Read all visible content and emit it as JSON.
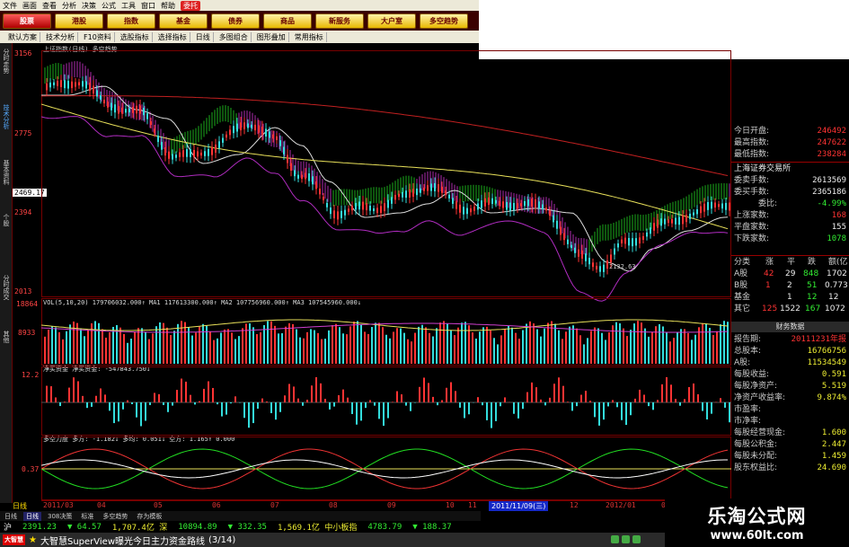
{
  "menu": {
    "items": [
      "文件",
      "画面",
      "查看",
      "分析",
      "决策",
      "公式",
      "工具",
      "窗口",
      "帮助"
    ],
    "badge": "委托"
  },
  "nav": {
    "buttons": [
      "股票",
      "港股",
      "指数",
      "基金",
      "债券",
      "商品",
      "新服务",
      "大户室",
      "多空趋势"
    ]
  },
  "toolbar": {
    "items": [
      "默认方案",
      "技术分析",
      "F10资料",
      "选股指标",
      "选择指标",
      "日线",
      "多图组合",
      "图形叠加",
      "常用指标"
    ]
  },
  "sidebar": {
    "tabs": [
      "分时走势",
      "技术分析",
      "基本资料",
      "个股",
      "分时成交",
      "其他"
    ]
  },
  "chart_header": {
    "text": "上证指数(日线)  多空趋势"
  },
  "price_axis": {
    "labels": [
      "3156",
      "2775",
      "2394",
      "2013"
    ],
    "current": "2469.17"
  },
  "low_annotation": "2132.63",
  "volume_pane": {
    "header": "VOL(5,10,20)  179706032.000↑ MA1  117613300.000↑ MA2  107756960.000↑ MA3  107545960.000↓",
    "labels": [
      "18864",
      "8933"
    ]
  },
  "netcap_pane": {
    "header": "净买资金  净买资金: -547843.750↓",
    "labels": [
      "12.2"
    ]
  },
  "trend_pane": {
    "header": "多空力度  多方: -1.182↓  多均: 0.051↓  空方: 1.165↑  0.000",
    "labels": [
      "0.37"
    ]
  },
  "x_axis": {
    "labels": [
      "2011/03",
      "04",
      "05",
      "06",
      "07",
      "08",
      "09",
      "10",
      "11",
      "12",
      "2012/01",
      "02"
    ],
    "date_flag": "2011/11/09(三)",
    "period_label": "日线"
  },
  "right_panel": {
    "quotes": [
      {
        "label": "今日开盘:",
        "value": "246492",
        "color": "red"
      },
      {
        "label": "最高指数:",
        "value": "247622",
        "color": "red"
      },
      {
        "label": "最低指数:",
        "value": "238284",
        "color": "red"
      }
    ],
    "exchange_title": "上海证券交易所",
    "orders": [
      {
        "label": "委卖手数:",
        "value": "2613569",
        "color": "white"
      },
      {
        "label": "委买手数:",
        "value": "2365186",
        "color": "white"
      },
      {
        "label": "委比:",
        "value": "-4.99%",
        "color": "green"
      },
      {
        "label": "上涨家数:",
        "value": "168",
        "color": "red"
      },
      {
        "label": "平盘家数:",
        "value": "155",
        "color": "white"
      },
      {
        "label": "下跌家数:",
        "value": "1078",
        "color": "green"
      }
    ],
    "table": {
      "headers": [
        "分类",
        "涨",
        "平",
        "跌",
        "额(亿"
      ],
      "rows": [
        [
          "A股",
          "42",
          "29",
          "848",
          "1702"
        ],
        [
          "B股",
          "1",
          "2",
          "51",
          "0.773"
        ],
        [
          "基金",
          "",
          "1",
          "12",
          "12"
        ],
        [
          "其它",
          "125",
          "1522",
          "167",
          "1072"
        ]
      ]
    },
    "finance_title": "财务数据",
    "finance": [
      {
        "label": "报告期:",
        "value": "20111231年报",
        "color": "red"
      },
      {
        "label": "总股本:",
        "value": "16766756",
        "color": "yellow"
      },
      {
        "label": "A股:",
        "value": "11534549",
        "color": "yellow"
      },
      {
        "label": "每股收益:",
        "value": "0.591",
        "color": "yellow"
      },
      {
        "label": "每股净资产:",
        "value": "5.519",
        "color": "yellow"
      },
      {
        "label": "净资产收益率:",
        "value": "9.874%",
        "color": "yellow"
      },
      {
        "label": "市盈率:",
        "value": "",
        "color": "yellow"
      },
      {
        "label": "市净率:",
        "value": "",
        "color": "yellow"
      },
      {
        "label": "每股经营现金:",
        "value": "1.600",
        "color": "yellow"
      },
      {
        "label": "每股公积金:",
        "value": "2.447",
        "color": "yellow"
      },
      {
        "label": "每股未分配:",
        "value": "1.459",
        "color": "yellow"
      },
      {
        "label": "股东权益比:",
        "value": "24.690",
        "color": "yellow"
      }
    ]
  },
  "bottom_tabs": [
    "日线",
    "日线",
    "308决策",
    "标准",
    "多空趋势",
    "存为模板"
  ],
  "ticker": [
    {
      "text": "沪",
      "color": "white"
    },
    {
      "text": "2391.23",
      "color": "green"
    },
    {
      "text": "▼ 64.57",
      "color": "green"
    },
    {
      "text": "1,707.4亿 深",
      "color": "yellow"
    },
    {
      "text": "10894.89",
      "color": "green"
    },
    {
      "text": "▼ 332.35",
      "color": "green"
    },
    {
      "text": "1,569.1亿 中小板指",
      "color": "yellow"
    },
    {
      "text": "4783.79",
      "color": "green"
    },
    {
      "text": "▼ 188.37",
      "color": "green"
    }
  ],
  "statusbar": {
    "logo": "大智慧",
    "message": "大智慧SuperView曝光今日主力资金路线",
    "page": "(3/14)"
  },
  "brand": {
    "name": "乐淘公式网",
    "url": "www.60lt.com"
  },
  "colors": {
    "up": "#ff3333",
    "down": "#33dddd",
    "band_green": "#22cc22",
    "band_magenta": "#cc33cc",
    "ma_yellow": "#e8e05a",
    "ma_red": "#c02020"
  }
}
